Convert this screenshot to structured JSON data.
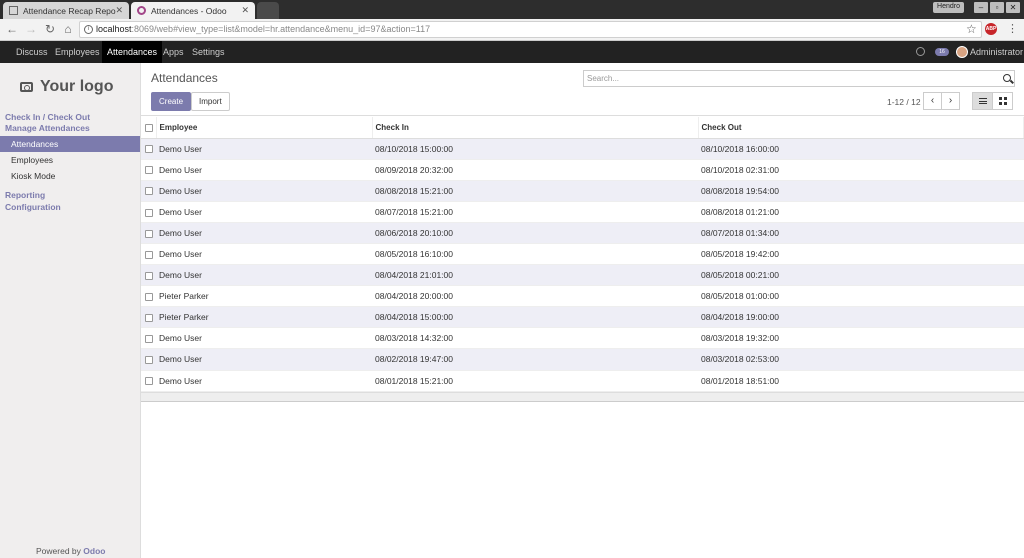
{
  "browser": {
    "tabs": [
      {
        "title": "Attendance Recap Repo"
      },
      {
        "title": "Attendances - Odoo"
      }
    ],
    "user_label": "Hendro",
    "url_host": "localhost",
    "url_rest": ":8069/web#view_type=list&model=hr.attendance&menu_id=97&action=117",
    "abp_label": "ABP"
  },
  "topbar": {
    "menus": [
      "Discuss",
      "Employees",
      "Attendances",
      "Apps",
      "Settings"
    ],
    "active_menu": "Attendances",
    "chat_count": "16",
    "user_name": "Administrator"
  },
  "sidebar": {
    "logo": "Your logo",
    "sections": [
      {
        "label": "Check In / Check Out"
      },
      {
        "label": "Manage Attendances"
      }
    ],
    "items": [
      {
        "label": "Attendances",
        "active": true
      },
      {
        "label": "Employees",
        "active": false
      },
      {
        "label": "Kiosk Mode",
        "active": false
      }
    ],
    "reporting": "Reporting",
    "configuration": "Configuration",
    "powered_prefix": "Powered by",
    "powered_brand": "Odoo"
  },
  "control": {
    "breadcrumb": "Attendances",
    "create_label": "Create",
    "import_label": "Import",
    "search_placeholder": "Search...",
    "pager": "1-12 / 12"
  },
  "table": {
    "columns": [
      "Employee",
      "Check In",
      "Check Out"
    ],
    "rows": [
      {
        "employee": "Demo User",
        "check_in": "08/10/2018 15:00:00",
        "check_out": "08/10/2018 16:00:00"
      },
      {
        "employee": "Demo User",
        "check_in": "08/09/2018 20:32:00",
        "check_out": "08/10/2018 02:31:00"
      },
      {
        "employee": "Demo User",
        "check_in": "08/08/2018 15:21:00",
        "check_out": "08/08/2018 19:54:00"
      },
      {
        "employee": "Demo User",
        "check_in": "08/07/2018 15:21:00",
        "check_out": "08/08/2018 01:21:00"
      },
      {
        "employee": "Demo User",
        "check_in": "08/06/2018 20:10:00",
        "check_out": "08/07/2018 01:34:00"
      },
      {
        "employee": "Demo User",
        "check_in": "08/05/2018 16:10:00",
        "check_out": "08/05/2018 19:42:00"
      },
      {
        "employee": "Demo User",
        "check_in": "08/04/2018 21:01:00",
        "check_out": "08/05/2018 00:21:00"
      },
      {
        "employee": "Pieter Parker",
        "check_in": "08/04/2018 20:00:00",
        "check_out": "08/05/2018 01:00:00"
      },
      {
        "employee": "Pieter Parker",
        "check_in": "08/04/2018 15:00:00",
        "check_out": "08/04/2018 19:00:00"
      },
      {
        "employee": "Demo User",
        "check_in": "08/03/2018 14:32:00",
        "check_out": "08/03/2018 19:32:00"
      },
      {
        "employee": "Demo User",
        "check_in": "08/02/2018 19:47:00",
        "check_out": "08/03/2018 02:53:00"
      },
      {
        "employee": "Demo User",
        "check_in": "08/01/2018 15:21:00",
        "check_out": "08/01/2018 18:51:00"
      }
    ]
  },
  "colors": {
    "brand": "#7c7bad",
    "topbar": "#222222",
    "row_stripe": "#eeeef6"
  }
}
